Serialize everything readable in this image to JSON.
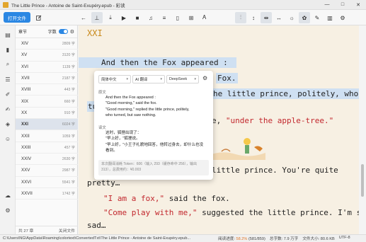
{
  "window": {
    "title": "The Little Prince - Antoine de Saint-Exupéry.epub - 彩读",
    "minimize": "—",
    "maximize": "□",
    "close": "✕"
  },
  "toolbar": {
    "open_file": "打开文件"
  },
  "chapter_panel": {
    "header_label": "章节",
    "word_count_label": "字数",
    "items": [
      {
        "name": "XIV",
        "count": "2809 字"
      },
      {
        "name": "XV",
        "count": "3120 字"
      },
      {
        "name": "XVI",
        "count": "1139 字"
      },
      {
        "name": "XVII",
        "count": "2187 字"
      },
      {
        "name": "XVIII",
        "count": "443 字"
      },
      {
        "name": "XIX",
        "count": "660 字"
      },
      {
        "name": "XX",
        "count": "910 字"
      },
      {
        "name": "XXI",
        "count": "6024 字"
      },
      {
        "name": "XXII",
        "count": "1059 字"
      },
      {
        "name": "XXIII",
        "count": "457 字"
      },
      {
        "name": "XXIV",
        "count": "2630 字"
      },
      {
        "name": "XXV",
        "count": "2987 字"
      },
      {
        "name": "XXVI",
        "count": "5541 字"
      },
      {
        "name": "XXVII",
        "count": "1742 字"
      }
    ],
    "selected": "XXI",
    "footer_total": "共 27 章",
    "footer_close": "关闭文件"
  },
  "reader": {
    "chapter_title": "XXI",
    "line1": "And then the Fox appeared :",
    "line2_tail": "Fox.",
    "line3_tail_a": "he little prince, politely, who",
    "line4_head": "tu",
    "line5_tail_a": "e, ",
    "line5_quote": "\"under the apple-tree.\"",
    "line6_tail": "little prince. You're quite",
    "line7": "pretty…",
    "line8_quote": "\"I am a fox,\"",
    "line8_rest": " said the fox.",
    "line9_quote": "\"Come play with me,\"",
    "line9_rest": " suggested the little prince. I'm so",
    "line10": "sad…"
  },
  "popup": {
    "lang_select": "简体中文",
    "engine_select": "AI 翻译",
    "model_select": "DeepSeek",
    "original_label": "原文",
    "original_lines": [
      "And then the Fox appeared :",
      "\"Good morning,\" said the fox.",
      "\"Good morning,\" replied the little prince, politely,",
      "who turned, but saw nothing."
    ],
    "translation_label": "译文",
    "translation_lines": [
      "这时，狐狸出现了：",
      "\"早上好，\"狐狸说。",
      "\"早上好，\"小王子礼貌地回答，他转过身去，却什么也没",
      "看到。"
    ],
    "stats_line1": "本次翻译消耗 Token：606（输入 293（缓存命中 256），输出",
    "stats_line2": "313），总费用约：¥0.003"
  },
  "status": {
    "path": "C:\\Users\\NG\\AppData\\Roaming\\colortext\\ConvertedTxt\\The Little Prince - Antoine de Saint-Exupéry.epub...",
    "progress_label": "阅读进度:",
    "progress_value": "58.2%",
    "progress_pos": "(581/859)",
    "total_words": "总字数: 7.9 万字",
    "file_size": "文件大小: 80.6 KB",
    "encoding": "UTF-8"
  },
  "colors": {
    "accent": "#2b87e3",
    "chapter_title": "#c98a1c",
    "quote": "#c2272d",
    "highlight": "#cfe0f2",
    "page_bg": "#f7f0e3",
    "progress": "#e0782a"
  },
  "icons": {
    "toolbar": [
      "arrow-left-icon",
      "pin-icon",
      "download-icon",
      "play-icon",
      "stop-icon",
      "headphones-icon",
      "list-icon",
      "bookmark-icon",
      "bookmark-add-icon",
      "text-size-icon",
      "filter-icon",
      "line-height-icon",
      "column-icon",
      "sun-icon",
      "palette-icon",
      "brush-icon",
      "sidebar-icon",
      "settings-icon"
    ],
    "rail": [
      "document-icon",
      "book-icon",
      "search-icon",
      "notes-icon",
      "highlight-icon",
      "translate-icon",
      "bookmark-icon",
      "sticker-icon",
      "cloud-icon",
      "settings-icon"
    ]
  }
}
